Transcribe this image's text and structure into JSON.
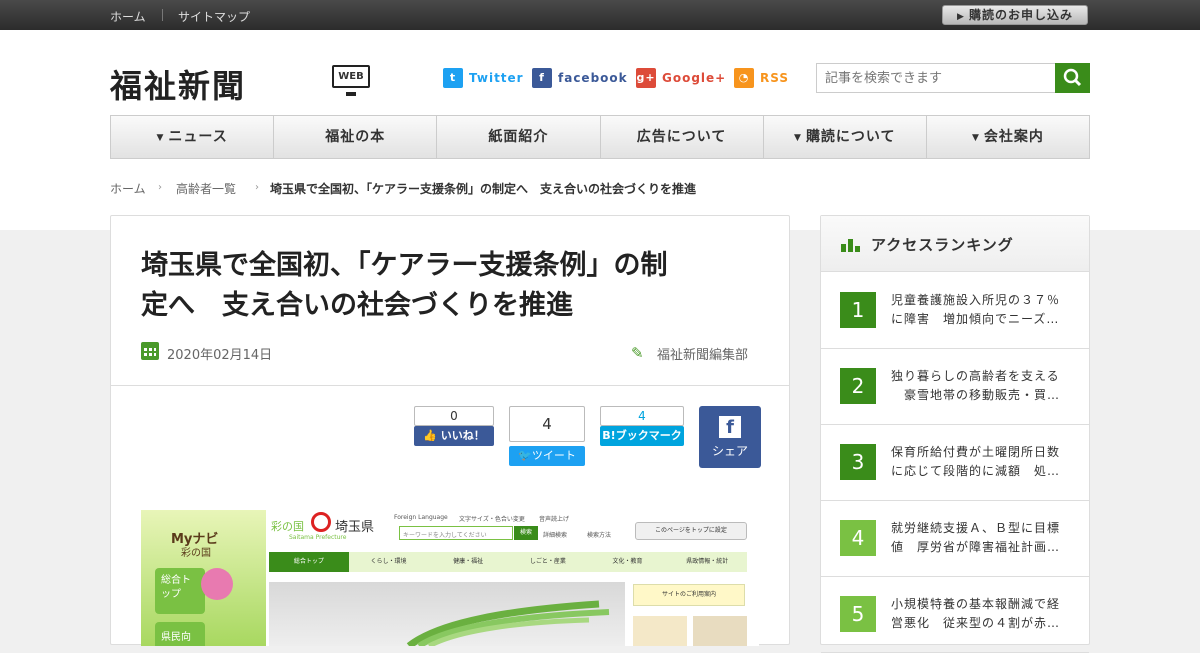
{
  "topbar": {
    "home": "ホーム",
    "sitemap": "サイトマップ",
    "subscribe": "購読のお申し込み"
  },
  "logo": {
    "text": "福祉新聞",
    "badge": "WEB"
  },
  "social": {
    "twitter": {
      "label": "Twitter",
      "color": "#1da1f2"
    },
    "facebook": {
      "label": "facebook",
      "color": "#3b5998"
    },
    "google": {
      "label": "Google+",
      "color": "#dd4b39"
    },
    "rss": {
      "label": "RSS",
      "color": "#f7941d"
    }
  },
  "search": {
    "placeholder": "記事を検索できます"
  },
  "nav": [
    "ニュース",
    "福祉の本",
    "紙面紹介",
    "広告について",
    "購読について",
    "会社案内"
  ],
  "breadcrumb": {
    "home": "ホーム",
    "category": "高齢者一覧",
    "current": "埼玉県で全国初、「ケアラー支援条例」の制定へ　支え合いの社会づくりを推進"
  },
  "article": {
    "title_line1": "埼玉県で全国初、「ケアラー支援条例」の制",
    "title_line2": "定へ　支え合いの社会づくりを推進",
    "date": "2020年02月14日",
    "author": "福祉新聞編集部"
  },
  "share": {
    "fb_count": "0",
    "fb_label": "いいね！",
    "tw_count": "4",
    "tw_label": "ツイート",
    "hb_count": "4",
    "hb_label": "B!ブックマーク",
    "fb_share": "シェア"
  },
  "photo": {
    "pref_logo": "埼玉県",
    "pref_sub": "彩の国",
    "pref_en": "Saitama Prefecture",
    "mynavi": "Myナビ",
    "mynavi_sub": "彩の国",
    "search_placeholder": "キーワードを入力してください",
    "search_btn": "検索",
    "set_top": "このページをトップに設定",
    "foreign": "Foreign Language",
    "fontsize": "文字サイズ・色合い変更",
    "voice": "音声読上げ",
    "detail_search": "詳細検索",
    "search_method": "検索方法",
    "tabs": [
      "総合トップ",
      "くらし・環境",
      "健康・福祉",
      "しごと・産業",
      "文化・教育",
      "県政情報・統計"
    ],
    "guide": "サイトのご利用案内",
    "side1": "総合トップ",
    "side2": "県民向け"
  },
  "ranking": {
    "title": "アクセスランキング",
    "items": [
      {
        "num": "1",
        "text": "児童養護施設入所児の３７％\nに障害　増加傾向でニーズ…",
        "color": "#3a8c1a"
      },
      {
        "num": "2",
        "text": "独り暮らしの高齢者を支える\n　豪雪地帯の移動販売・買…",
        "color": "#3a8c1a"
      },
      {
        "num": "3",
        "text": "保育所給付費が土曜閉所日数\nに応じて段階的に減額　処…",
        "color": "#3a8c1a"
      },
      {
        "num": "4",
        "text": "就労継続支援Ａ、Ｂ型に目標\n値　厚労省が障害福祉計画…",
        "color": "#7ac143"
      },
      {
        "num": "5",
        "text": "小規模特養の基本報酬減で経\n営悪化　従来型の４割が赤…",
        "color": "#7ac143"
      }
    ]
  }
}
